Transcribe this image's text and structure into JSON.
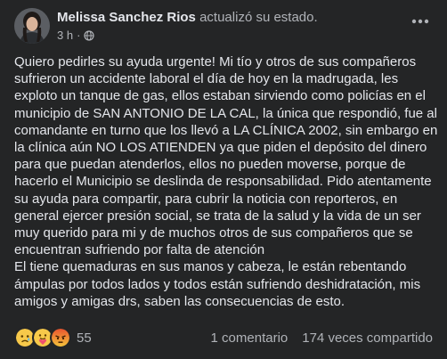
{
  "header": {
    "author": "Melissa Sanchez Rios",
    "action": "actualizó su estado.",
    "time": "3 h",
    "separator": "·",
    "privacy_icon": "globe-icon",
    "more_icon": "more-options-icon"
  },
  "post": {
    "text": "Quiero pedirles su ayuda urgente! Mi tío y otros de sus compañeros sufrieron un accidente laboral el día de hoy en la madrugada, les exploto un tanque de gas, ellos estaban sirviendo como policías en el municipio de SAN ANTONIO DE LA CAL, la única que respondió, fue al comandante en turno que los llevó a LA CLÍNICA 2002, sin embargo en la clínica aún NO LOS ATIENDEN ya que piden el depósito del dinero para que puedan atenderlos, ellos no pueden moverse, porque de hacerlo el Municipio se deslinda de responsabilidad. Pido atentamente su ayuda para compartir, para cubrir la noticia con reporteros, en general ejercer presión social, se trata de la salud y la vida de un ser muy querido para mi y de muchos otros de sus compañeros que se encuentran sufriendo por falta de atención\nEl tiene quemaduras en sus manos y cabeza, le están rebentando ámpulas por todos lados y todos están sufriendo deshidratación, mis amigos y amigas drs, saben las consecuencias de esto."
  },
  "footer": {
    "reaction_icons": [
      "sad-reaction-icon",
      "care-reaction-icon",
      "angry-reaction-icon"
    ],
    "reaction_count": "55",
    "comments": "1 comentario",
    "shares": "174 veces compartido"
  },
  "colors": {
    "background": "#242526",
    "primary_text": "#e4e6eb",
    "secondary_text": "#b0b3b8"
  }
}
